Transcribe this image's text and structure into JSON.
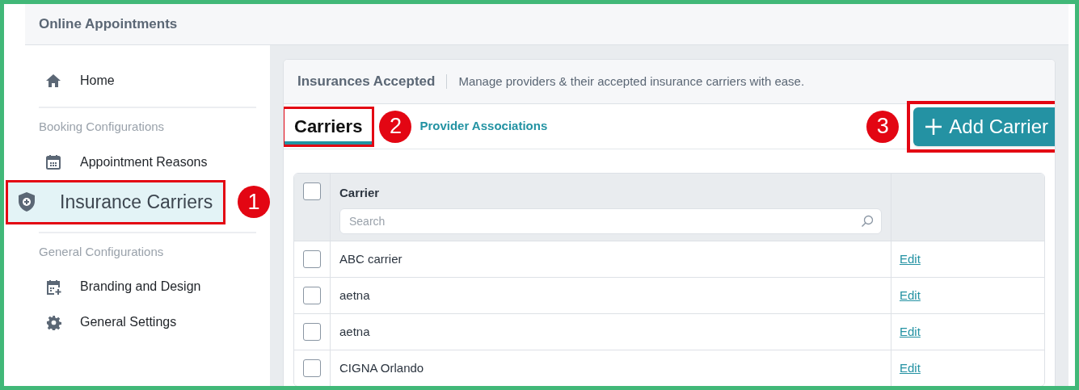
{
  "header": {
    "title": "Online Appointments"
  },
  "sidebar": {
    "items": [
      {
        "label": "Home",
        "selected": false,
        "highlighted": false
      }
    ],
    "sections": [
      {
        "heading": "Booking Configurations",
        "items": [
          {
            "label": "Appointment Reasons",
            "selected": false,
            "highlighted": false
          },
          {
            "label": "Insurance Carriers",
            "selected": true,
            "highlighted": true,
            "callout": "1"
          }
        ]
      },
      {
        "heading": "General Configurations",
        "items": [
          {
            "label": "Branding and Design",
            "selected": false,
            "highlighted": false
          },
          {
            "label": "General Settings",
            "selected": false,
            "highlighted": false
          }
        ]
      }
    ]
  },
  "card": {
    "title": "Insurances Accepted",
    "subtitle": "Manage providers & their accepted insurance carriers with ease.",
    "tabs": [
      {
        "label": "Carriers",
        "selected": true,
        "highlighted": true,
        "callout": "2"
      },
      {
        "label": "Provider Associations",
        "selected": false,
        "highlighted": false
      }
    ],
    "add_button": {
      "label": "Add Carrier",
      "highlighted": true,
      "callout": "3"
    },
    "table": {
      "select_all": {
        "checked": false
      },
      "columns": [
        "Carrier"
      ],
      "search": {
        "placeholder": "Search"
      },
      "rows": [
        {
          "checked": false,
          "carrier": "ABC carrier",
          "action": "Edit"
        },
        {
          "checked": false,
          "carrier": "aetna",
          "action": "Edit"
        },
        {
          "checked": false,
          "carrier": "aetna",
          "action": "Edit"
        },
        {
          "checked": false,
          "carrier": "CIGNA Orlando",
          "action": "Edit"
        }
      ]
    }
  }
}
